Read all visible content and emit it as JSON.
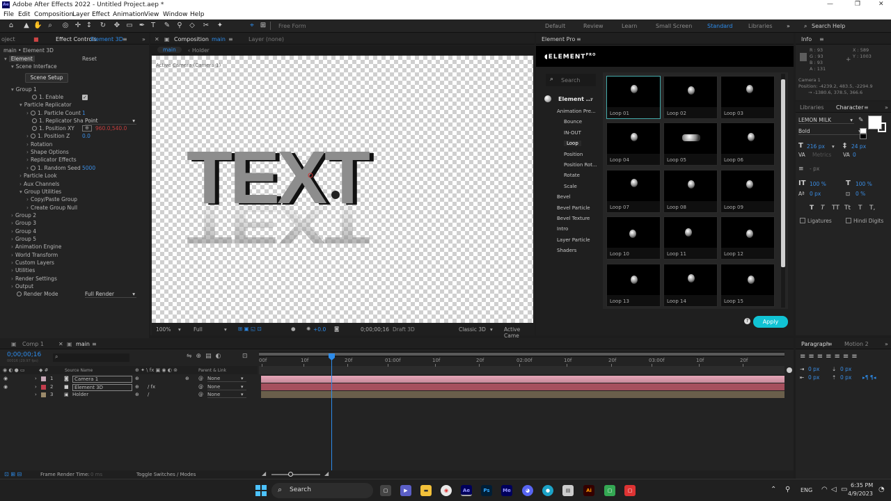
{
  "window": {
    "title": "Adobe After Effects 2022 - Untitled Project.aep *",
    "app_badge": "Ae"
  },
  "menu": [
    "File",
    "Edit",
    "Composition",
    "Layer",
    "Effect",
    "Animation",
    "View",
    "Window",
    "Help"
  ],
  "toolbar": {
    "free_form": "Free Form",
    "workspaces": [
      "Default",
      "Review",
      "Learn",
      "Small Screen",
      "Standard",
      "Libraries"
    ],
    "active_workspace": "Standard",
    "search_help": "Search Help"
  },
  "effect_controls": {
    "project_tab": "oject",
    "tab_label": "Effect Controls",
    "tab_layer": "Element 3D",
    "breadcrumb": "main • Element 3D",
    "fx_name": "Element",
    "reset": "Reset",
    "scene_interface": "Scene Interface",
    "scene_setup": "Scene Setup",
    "rows": {
      "group1": "Group 1",
      "enable": "1. Enable",
      "particle_replicator": "Particle Replicator",
      "particle_count": "1. Particle Count",
      "particle_count_val": "1",
      "replicator_shape": "1. Replicator Sha",
      "replicator_shape_val": "Point",
      "position_xy": "1. Position XY",
      "position_xy_val": "960.0,540.0",
      "position_z": "1. Position Z",
      "position_z_val": "0.0",
      "rotation": "Rotation",
      "shape_options": "Shape Options",
      "replicator_effects": "Replicator Effects",
      "random_seed": "1. Random Seed",
      "random_seed_val": "5000",
      "particle_look": "Particle Look",
      "aux_channels": "Aux Channels",
      "group_utilities": "Group Utilities",
      "copy_paste": "Copy/Paste Group",
      "create_null": "Create Group Null",
      "group2": "Group 2",
      "group3": "Group 3",
      "group4": "Group 4",
      "group5": "Group 5",
      "animation_engine": "Animation Engine",
      "world_transform": "World Transform",
      "custom_layers": "Custom Layers",
      "utilities": "Utilities",
      "render_settings": "Render Settings",
      "output": "Output",
      "render_mode": "Render Mode",
      "render_mode_val": "Full Render"
    }
  },
  "composition": {
    "tab_label": "Composition",
    "tab_comp": "main",
    "layer_tab": "Layer (none)",
    "subtab_main": "main",
    "subtab_holder": "Holder",
    "camera_label": "Active Camera (Camera 1)",
    "text_3d": "TEXT",
    "footer": {
      "zoom": "100%",
      "resolution": "Full",
      "exposure": "+0.0",
      "timecode": "0;00;00;16",
      "renderer": "Draft 3D",
      "view_mode": "Classic 3D",
      "camera": "Active Came"
    }
  },
  "element_pro": {
    "tab_label": "Element Pro",
    "brand": "ELEMENT",
    "brand_sup": "PRO",
    "search_placeholder": "Search",
    "root": "Element ...",
    "categories": [
      {
        "label": "Animation Pre...",
        "indent": 1
      },
      {
        "label": "Bounce",
        "indent": 2
      },
      {
        "label": "IN-OUT",
        "indent": 2
      },
      {
        "label": "Loop",
        "indent": 2,
        "selected": true
      },
      {
        "label": "Position",
        "indent": 2
      },
      {
        "label": "Position Rot...",
        "indent": 2
      },
      {
        "label": "Rotate",
        "indent": 2
      },
      {
        "label": "Scale",
        "indent": 2
      },
      {
        "label": "Bevel",
        "indent": 1
      },
      {
        "label": "Bevel Particle",
        "indent": 1
      },
      {
        "label": "Bevel Texture",
        "indent": 1
      },
      {
        "label": "Intro",
        "indent": 1
      },
      {
        "label": "Layer Particle",
        "indent": 1
      },
      {
        "label": "Shaders",
        "indent": 1
      }
    ],
    "presets": [
      "Loop 01",
      "Loop 02",
      "Loop 03",
      "Loop 04",
      "Loop 05",
      "Loop 06",
      "Loop 07",
      "Loop 08",
      "Loop 09",
      "Loop 10",
      "Loop 11",
      "Loop 12",
      "Loop 13",
      "Loop 14",
      "Loop 15"
    ],
    "apply": "Apply",
    "help": "?"
  },
  "info": {
    "tab_label": "Info",
    "r": "R : 93",
    "g": "G : 93",
    "b": "B : 93",
    "a": "A : 131",
    "x": "X : 589",
    "y": "Y : 1003",
    "camera": "Camera 1",
    "position": "Position: -4239.2, 483.5, -2294.9",
    "position2": "→ -1380.6, 378.5, 366.6"
  },
  "character": {
    "libraries_tab": "Libraries",
    "tab_label": "Character",
    "font": "LEMON MILK",
    "style": "Bold",
    "font_size": "216 px",
    "leading": "24 px",
    "tracking": "0",
    "stroke_width": "- px",
    "vscale": "100 %",
    "hscale": "100 %",
    "baseline": "0 px",
    "tsume": "0 %",
    "styles": [
      "T",
      "T",
      "TT",
      "Tt",
      "T",
      "T,"
    ],
    "ligatures": "Ligatures",
    "hindi_digits": "Hindi Digits"
  },
  "paragraph": {
    "tab_label": "Paragraph",
    "motion_tab": "Motion 2",
    "indent_vals": [
      "0 px",
      "0 px",
      "0 px",
      "0 px",
      "0 px"
    ]
  },
  "timeline": {
    "tab_comp1": "Comp 1",
    "tab_main": "main",
    "timecode": "0;00;00;16",
    "timecode_sub": "00016 (29.97 fps)",
    "col_source": "Source Name",
    "col_parent": "Parent & Link",
    "layers": [
      {
        "num": "1",
        "name": "Camera 1",
        "parent": "None",
        "color": "#c8a8b8"
      },
      {
        "num": "2",
        "name": "Element 3D",
        "parent": "None",
        "color": "#c43c4c"
      },
      {
        "num": "3",
        "name": "Holder",
        "parent": "None",
        "color": "#9b8a6a"
      }
    ],
    "ruler": [
      "00f",
      "10f",
      "20f",
      "01:00f",
      "10f",
      "20f",
      "02:00f",
      "10f",
      "20f",
      "03:00f",
      "10f",
      "20f"
    ],
    "footer_render": "Frame Render Time:",
    "footer_render_val": "0 ms",
    "footer_toggle": "Toggle Switches / Modes"
  },
  "taskbar": {
    "search": "Search",
    "lang": "ENG",
    "time": "6:35 PM",
    "date": "4/9/2023"
  }
}
